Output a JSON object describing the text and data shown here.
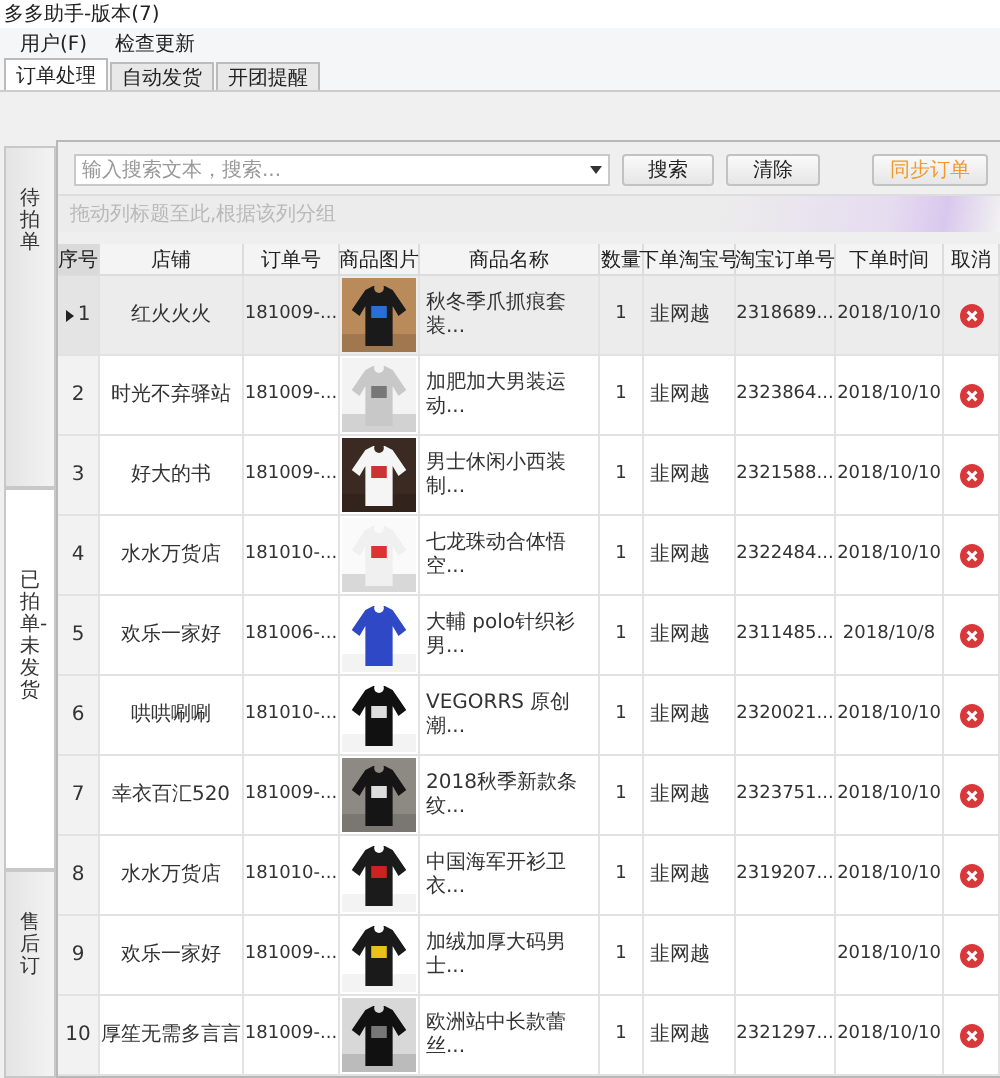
{
  "window": {
    "title": "多多助手-版本(7)"
  },
  "menu": [
    "用户(F)",
    "检查更新"
  ],
  "tabs": [
    {
      "label": "订单处理",
      "selected": true
    },
    {
      "label": "自动发货",
      "selected": false
    },
    {
      "label": "开团提醒",
      "selected": false
    }
  ],
  "side_tabs": [
    {
      "label": "待拍单",
      "selected": false
    },
    {
      "label": "已拍单-未发货",
      "selected": true
    },
    {
      "label": "售后订",
      "selected": false
    }
  ],
  "search": {
    "placeholder": "输入搜索文本，搜索..."
  },
  "buttons": [
    {
      "label": "搜索",
      "kind": "plain"
    },
    {
      "label": "清除",
      "kind": "plain"
    },
    {
      "label": "同步订单",
      "kind": "accent"
    }
  ],
  "group_hint": "拖动列标题至此,根据该列分组",
  "table": {
    "columns": [
      "序号",
      "店铺",
      "订单号",
      "商品图片",
      "商品名称",
      "数量",
      "下单淘宝号",
      "淘宝订单号",
      "下单时间",
      "取消"
    ],
    "rows": [
      {
        "selected": true,
        "no": "1",
        "shop": "红火火火",
        "order": "181009-...",
        "name": "秋冬季爪抓痕套装...",
        "qty": "1",
        "buyer": "韭网越",
        "taobao_order": "2318689...",
        "time": "2018/10/10"
      },
      {
        "selected": false,
        "no": "2",
        "shop": "时光不弃驿站",
        "order": "181009-...",
        "name": "加肥加大男装运动...",
        "qty": "1",
        "buyer": "韭网越",
        "taobao_order": "2323864...",
        "time": "2018/10/10"
      },
      {
        "selected": false,
        "no": "3",
        "shop": "好大的书",
        "order": "181009-...",
        "name": "男士休闲小西装制...",
        "qty": "1",
        "buyer": "韭网越",
        "taobao_order": "2321588...",
        "time": "2018/10/10"
      },
      {
        "selected": false,
        "no": "4",
        "shop": "水水万货店",
        "order": "181010-...",
        "name": "七龙珠动合体悟空...",
        "qty": "1",
        "buyer": "韭网越",
        "taobao_order": "2322484...",
        "time": "2018/10/10"
      },
      {
        "selected": false,
        "no": "5",
        "shop": "欢乐一家好",
        "order": "181006-...",
        "name": "大輔 polo针织衫男...",
        "qty": "1",
        "buyer": "韭网越",
        "taobao_order": "2311485...",
        "time": "2018/10/8"
      },
      {
        "selected": false,
        "no": "6",
        "shop": "哄哄唰唰",
        "order": "181010-...",
        "name": "VEGORRS 原创潮...",
        "qty": "1",
        "buyer": "韭网越",
        "taobao_order": "2320021...",
        "time": "2018/10/10"
      },
      {
        "selected": false,
        "no": "7",
        "shop": "幸衣百汇520",
        "order": "181009-...",
        "name": "2018秋季新款条纹...",
        "qty": "1",
        "buyer": "韭网越",
        "taobao_order": "2323751...",
        "time": "2018/10/10"
      },
      {
        "selected": false,
        "no": "8",
        "shop": "水水万货店",
        "order": "181010-...",
        "name": "中国海军开衫卫衣...",
        "qty": "1",
        "buyer": "韭网越",
        "taobao_order": "2319207...",
        "time": "2018/10/10"
      },
      {
        "selected": false,
        "no": "9",
        "shop": "欢乐一家好",
        "order": "181009-...",
        "name": "加绒加厚大码男士...",
        "qty": "1",
        "buyer": "韭网越",
        "time": "2018/10/10"
      },
      {
        "selected": false,
        "no": "10",
        "shop": "厚笙无需多言言",
        "order": "181009-...",
        "name": "欧洲站中长款蕾丝...",
        "qty": "1",
        "buyer": "韭网越",
        "taobao_order": "2321297...",
        "time": "2018/10/10"
      }
    ]
  }
}
